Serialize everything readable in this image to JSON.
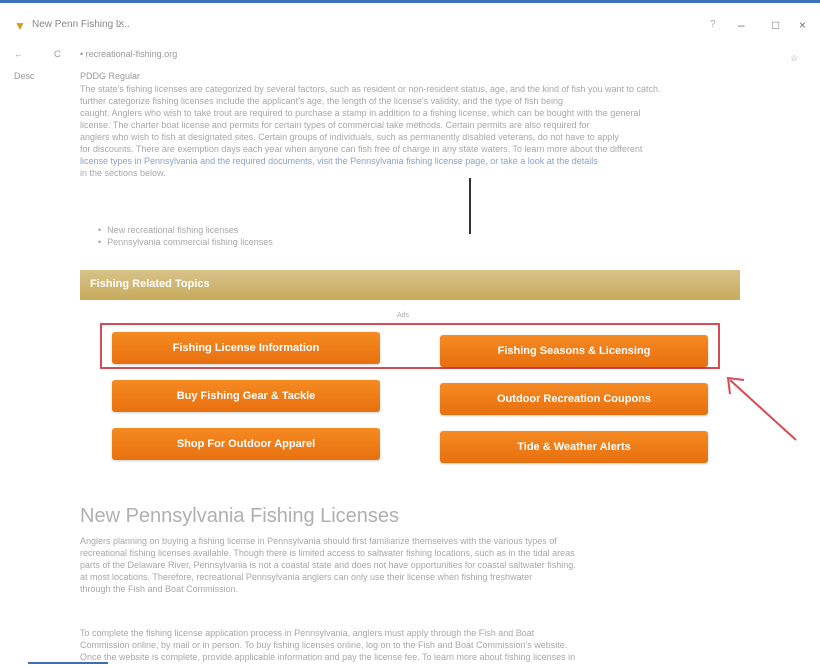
{
  "titlebar": {
    "tab_title": "New Penn Fishing L...",
    "close_glyph": "×",
    "other": "?",
    "minimize": "–",
    "maximize": "□",
    "close": "×"
  },
  "nav": {
    "back": "←",
    "forward": "C",
    "crumb": "•  recreational-fishing.org",
    "corner": "☆"
  },
  "meta": {
    "left_label": "Desc",
    "right_label": "PDDG Regular"
  },
  "intro_paragraph": {
    "lines": [
      "The state's fishing licenses are categorized by several factors, such as resident or non-resident status, age, and the kind of fish you want to catch.",
      "further categorize fishing licenses include the applicant's age, the length of the license's validity, and the type of fish being",
      "caught. Anglers who wish to take trout are required to purchase a stamp in addition to a fishing license, which can be bought with the general",
      "license. The charter boat license and permits for certain types of commercial take methods. Certain permits are also required for",
      "anglers who wish to fish at designated sites. Certain groups of individuals, such as permanently disabled veterans, do not have to apply",
      "for discounts. There are exemption days each year when anyone can fish free of charge in any state waters. To learn more about the different",
      "license types in Pennsylvania and the required documents, visit the Pennsylvania fishing license page, or take a look at the details",
      "in the sections below."
    ]
  },
  "bullets": [
    "New recreational fishing licenses",
    "Pennsylvania commercial fishing licenses"
  ],
  "topics": {
    "header": "Fishing Related Topics",
    "ad_label": "Ads",
    "buttons": [
      "Fishing License Information",
      "Fishing Seasons & Licensing",
      "Buy Fishing Gear & Tackle",
      "Outdoor Recreation Coupons",
      "Shop For Outdoor Apparel",
      "Tide & Weather Alerts"
    ]
  },
  "section": {
    "title": "New Pennsylvania Fishing Licenses",
    "paragraph1": [
      "Anglers planning on buying a fishing license in Pennsylvania should first familiarize themselves with the various types of",
      "recreational fishing licenses available. Though there is limited access to saltwater fishing locations, such as in the tidal areas",
      "parts of the Delaware River, Pennsylvania is not a coastal state and does not have opportunities for coastal saltwater fishing.",
      "at most locations. Therefore, recreational Pennsylvania anglers can only use their license when fishing freshwater",
      "through the Fish and Boat Commission."
    ],
    "paragraph2": [
      "To complete the fishing license application process in Pennsylvania, anglers must apply through the Fish and Boat",
      "Commission online, by mail or in person. To buy fishing licenses online, log on to the Fish and Boat Commission's website.",
      "Once the website is complete, provide applicable information and pay the license fee. To learn more about fishing licenses in"
    ]
  },
  "colors": {
    "button": "#f07c1a",
    "topics_bar": "#cdb36a",
    "highlight": "#d74b53",
    "accent_blue": "#3f6fb6"
  }
}
